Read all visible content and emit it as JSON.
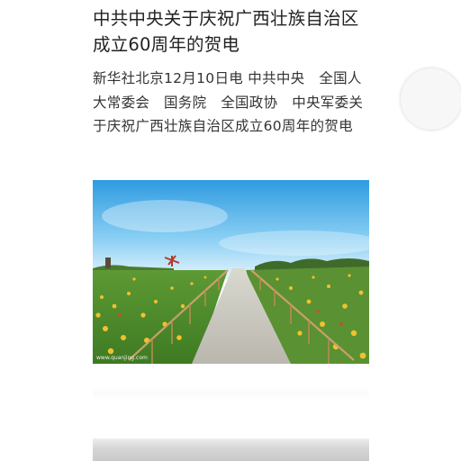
{
  "article": {
    "title": "中共中央关于庆祝广西壮族自治区成立60周年的贺电",
    "lead": "新华社北京12月10日电 中共中央　全国人大常委会　国务院　全国政协　中央军委关于庆祝广西壮族自治区成立60周年的贺电"
  },
  "photo": {
    "watermark": "www.quanjing.com"
  },
  "colors": {
    "title": "#222222",
    "text": "#333333",
    "sky": "#4fb3ea",
    "field": "#6aa33a",
    "flowers": "#f2c12e"
  }
}
